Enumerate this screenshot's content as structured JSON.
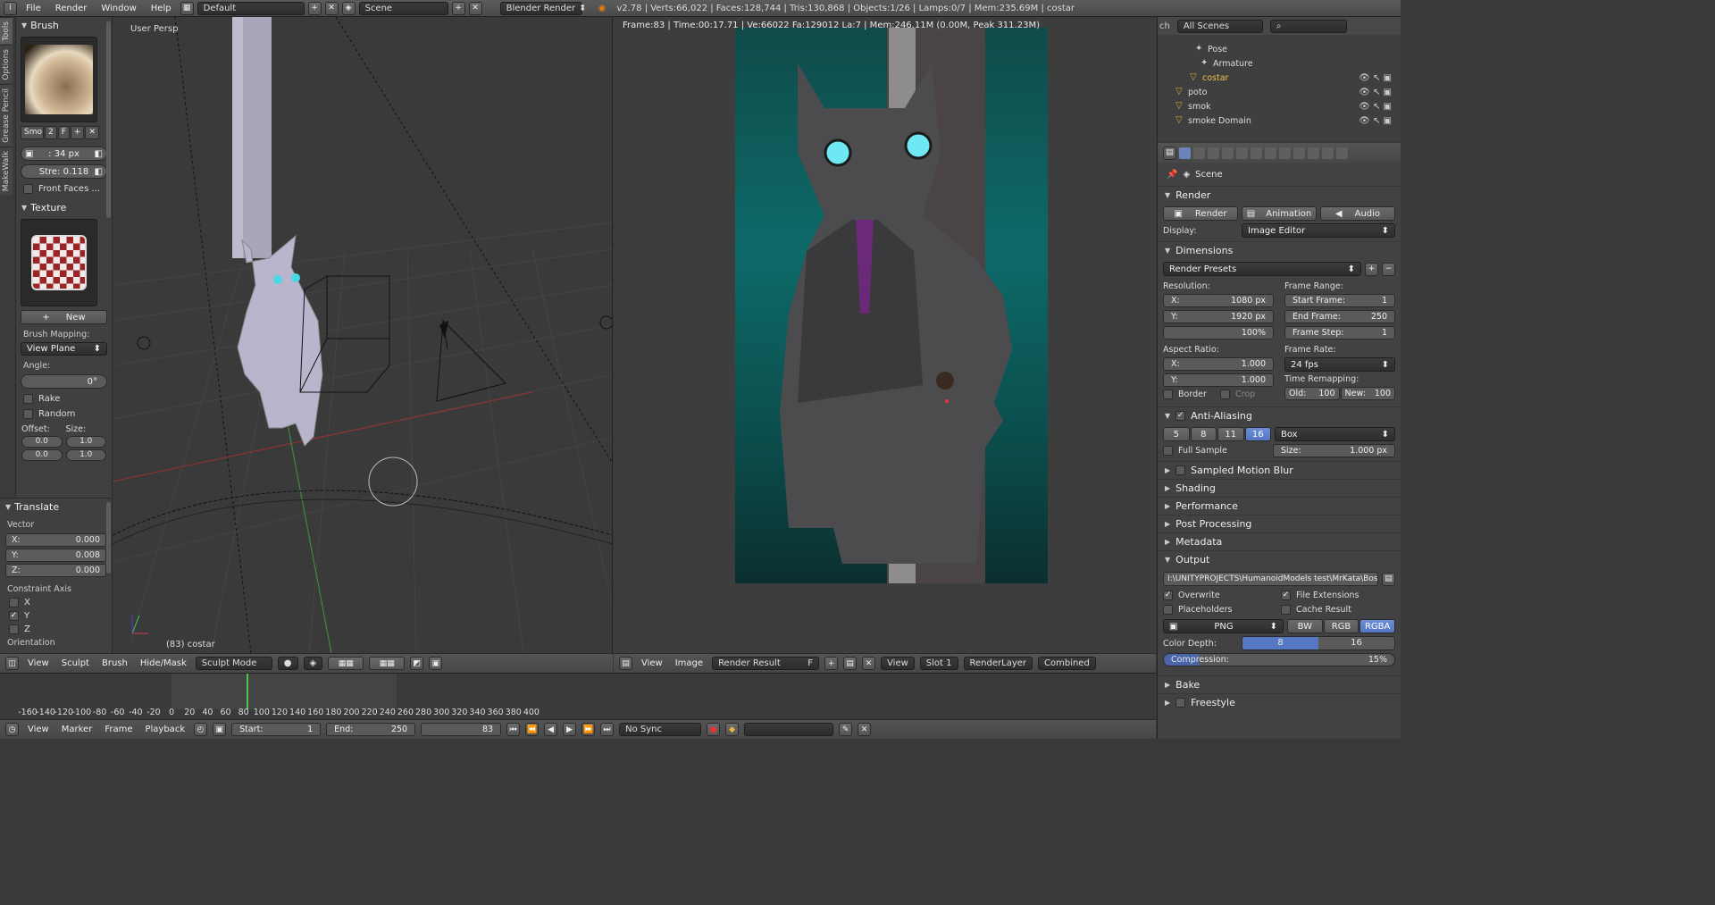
{
  "topbar": {
    "menus": [
      "File",
      "Render",
      "Window",
      "Help"
    ],
    "layout": "Default",
    "scene": "Scene",
    "engine": "Blender Render",
    "stats": "v2.78 | Verts:66,022 | Faces:128,744 | Tris:130,868 | Objects:1/26 | Lamps:0/7 | Mem:235.69M | costar"
  },
  "tooltabs": [
    "Tools",
    "Options",
    "Grease Pencil",
    "MakeWalk"
  ],
  "brush": {
    "title": "Brush",
    "name": "Smo",
    "users": "2",
    "fake": "F",
    "radius": ": 34 px",
    "strength": "Stre: 0.118",
    "front_faces": "Front Faces ..."
  },
  "texture": {
    "title": "Texture",
    "new_label": "New",
    "mapping_label": "Brush Mapping:",
    "mapping_value": "View Plane",
    "angle_label": "Angle:",
    "angle_value": "0°",
    "rake": "Rake",
    "random": "Random",
    "offset_label": "Offset:",
    "size_label": "Size:",
    "offset_x": "0.0",
    "offset_y": "0.0",
    "size_x": "1.0",
    "size_y": "1.0"
  },
  "translate": {
    "title": "Translate",
    "vector_label": "Vector",
    "x_label": "X:",
    "x": "0.000",
    "y_label": "Y:",
    "y": "0.008",
    "z_label": "Z:",
    "z": "0.000",
    "constraint_label": "Constraint Axis",
    "cx": "X",
    "cy": "Y",
    "cz": "Z",
    "orientation_label": "Orientation"
  },
  "viewport": {
    "label": "User Persp",
    "object": "(83) costar"
  },
  "viewport_header": {
    "items": [
      "View",
      "Sculpt",
      "Brush",
      "Hide/Mask"
    ],
    "mode": "Sculpt Mode"
  },
  "render_view": {
    "info": "Frame:83 | Time:00:17.71 | Ve:66022 Fa:129012 La:7 | Mem:246.11M (0.00M, Peak 311.23M)"
  },
  "image_header": {
    "items": [
      "View",
      "Image"
    ],
    "image": "Render Result",
    "fake": "F",
    "view": "View",
    "slot": "Slot 1",
    "layer": "RenderLayer",
    "pass": "Combined"
  },
  "timeline": {
    "ticks": [
      "-160",
      "-140",
      "-120",
      "-100",
      "-80",
      "-60",
      "-40",
      "-20",
      "0",
      "20",
      "40",
      "60",
      "80",
      "100",
      "120",
      "140",
      "160",
      "180",
      "200",
      "220",
      "240",
      "260",
      "280",
      "300",
      "320",
      "340",
      "360",
      "380",
      "400"
    ],
    "current_frame": 83
  },
  "timeline_header": {
    "items": [
      "View",
      "Marker",
      "Frame",
      "Playback"
    ],
    "start": "Start:",
    "start_val": "1",
    "end": "End:",
    "end_val": "250",
    "current": "83",
    "sync": "No Sync"
  },
  "outliner": {
    "filter": "All Scenes",
    "ch": "ch",
    "items": [
      {
        "name": "Pose",
        "indent": 2
      },
      {
        "name": "Armature",
        "indent": 2
      },
      {
        "name": "costar",
        "indent": 1
      },
      {
        "name": "poto",
        "indent": 0
      },
      {
        "name": "smok",
        "indent": 0
      },
      {
        "name": "smoke Domain",
        "indent": 0
      }
    ]
  },
  "properties": {
    "context": "Scene",
    "render_title": "Render",
    "render_btn": "Render",
    "animation_btn": "Animation",
    "audio_btn": "Audio",
    "display_label": "Display:",
    "display_value": "Image Editor",
    "dimensions_title": "Dimensions",
    "presets": "Render Presets",
    "resolution_label": "Resolution:",
    "res_x_label": "X:",
    "res_x": "1080 px",
    "res_y_label": "Y:",
    "res_y": "1920 px",
    "res_pct": "100%",
    "frame_range_label": "Frame Range:",
    "start_frame_label": "Start Frame:",
    "start_frame": "1",
    "end_frame_label": "End Frame:",
    "end_frame": "250",
    "frame_step_label": "Frame Step:",
    "frame_step": "1",
    "aspect_label": "Aspect Ratio:",
    "asp_x_label": "X:",
    "asp_x": "1.000",
    "asp_y_label": "Y:",
    "asp_y": "1.000",
    "frame_rate_label": "Frame Rate:",
    "frame_rate": "24 fps",
    "time_remap_label": "Time Remapping:",
    "old_label": "Old:",
    "old": "100",
    "new_label": "New:",
    "new": "100",
    "border": "Border",
    "crop": "Crop",
    "aa_title": "Anti-Aliasing",
    "aa_samples": [
      "5",
      "8",
      "11",
      "16"
    ],
    "aa_filter": "Box",
    "full_sample": "Full Sample",
    "size_label": "Size:",
    "size_val": "1.000 px",
    "collapsed": [
      "Sampled Motion Blur",
      "Shading",
      "Performance",
      "Post Processing",
      "Metadata"
    ],
    "output_title": "Output",
    "output_path": "I:\\UNITYPROJECTS\\HumanoidModels test\\MrKata\\BossRe...",
    "overwrite": "Overwrite",
    "file_ext": "File Extensions",
    "placeholders": "Placeholders",
    "cache": "Cache Result",
    "format": "PNG",
    "bw": "BW",
    "rgb": "RGB",
    "rgba": "RGBA",
    "color_depth_label": "Color Depth:",
    "depth8": "8",
    "depth16": "16",
    "compression_label": "Compression:",
    "compression": "15%",
    "compression_value": 0.15,
    "bake": "Bake",
    "freestyle": "Freestyle"
  }
}
